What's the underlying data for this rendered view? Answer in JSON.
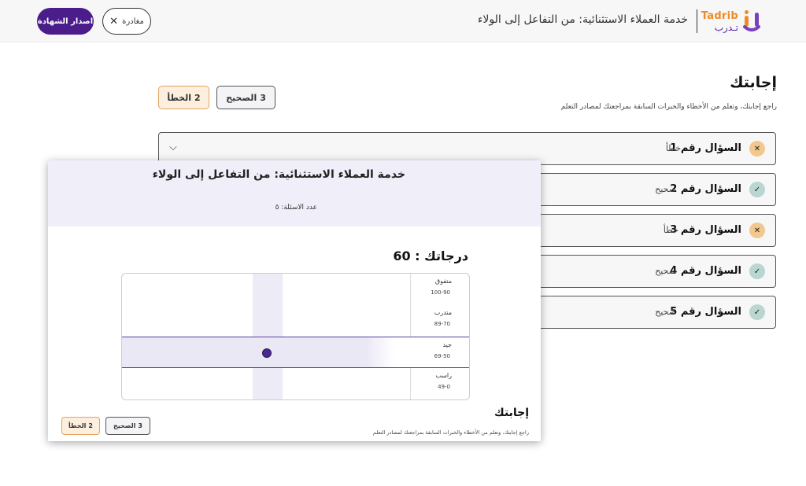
{
  "header": {
    "title": "خدمة العملاء الاستثنائية: من التفاعل إلى الولاء",
    "logo_latin": "Tadrib",
    "logo_arabic": "تـدرب",
    "exit_label": "مغادرة",
    "certificate_label": "اصدار الشهادة"
  },
  "answers": {
    "title": "إجابتك",
    "subtitle": "راجع إجابتك، وتعلم من الأخطاء والخبرات السابقة بمراجعتك لمصادر التعلم",
    "correct_label": "الصحيح",
    "correct_count": "3",
    "wrong_label": "الخطأ",
    "wrong_count": "2"
  },
  "questions": [
    {
      "label": "السؤال رقم 1",
      "status": "خطأ",
      "correct": false
    },
    {
      "label": "السؤال رقم 2",
      "status": "صحيح",
      "correct": true
    },
    {
      "label": "السؤال رقم 3",
      "status": "خطأ",
      "correct": false
    },
    {
      "label": "السؤال رقم 4",
      "status": "صحيح",
      "correct": true
    },
    {
      "label": "السؤال رقم 5",
      "status": "صحيح",
      "correct": true
    }
  ],
  "certificate_preview": {
    "title": "خدمة العملاء الاستثنائية: من التفاعل إلى الولاء",
    "question_count": "عدد الاسئلة: ٥",
    "score": "درجاتك : 60",
    "grades": [
      {
        "name": "متفوق",
        "range": "100-90"
      },
      {
        "name": "متدرب",
        "range": "89-70"
      },
      {
        "name": "جيد",
        "range": "69-50",
        "active": true
      },
      {
        "name": "راسب",
        "range": "49-0"
      }
    ],
    "answers_title": "إجابتك",
    "answers_subtitle": "راجع إجابتك، وتعلم من الأخطاء والخبرات السابقة بمراجعتك لمصادر التعلم",
    "correct_label": "الصحيح",
    "correct_count": "3",
    "wrong_label": "الخطأ",
    "wrong_count": "2"
  },
  "colors": {
    "brand_purple": "#4a1d8a",
    "brand_orange": "#f08a24",
    "wrong_badge": "#f1c98f",
    "correct_badge": "#b9d6d0"
  }
}
